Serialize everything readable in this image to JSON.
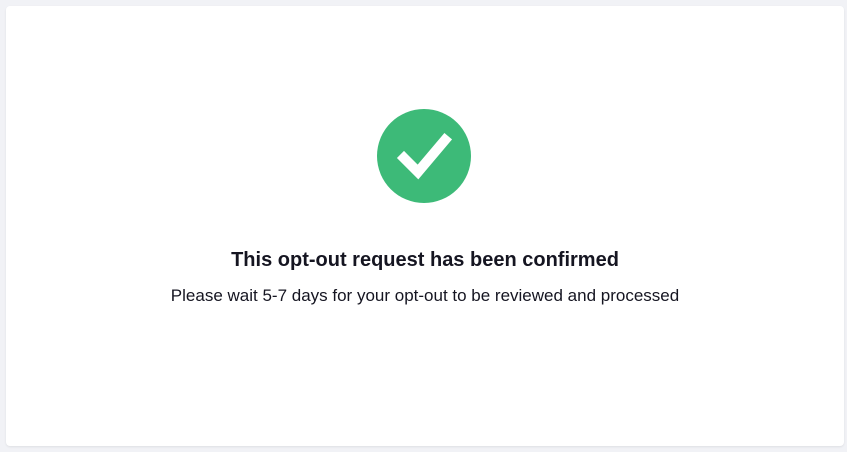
{
  "confirmation": {
    "icon": "checkmark-circle-icon",
    "icon_color": "#3dba78",
    "title": "This opt-out request has been confirmed",
    "message": "Please wait 5-7 days for your opt-out to be reviewed and processed"
  }
}
